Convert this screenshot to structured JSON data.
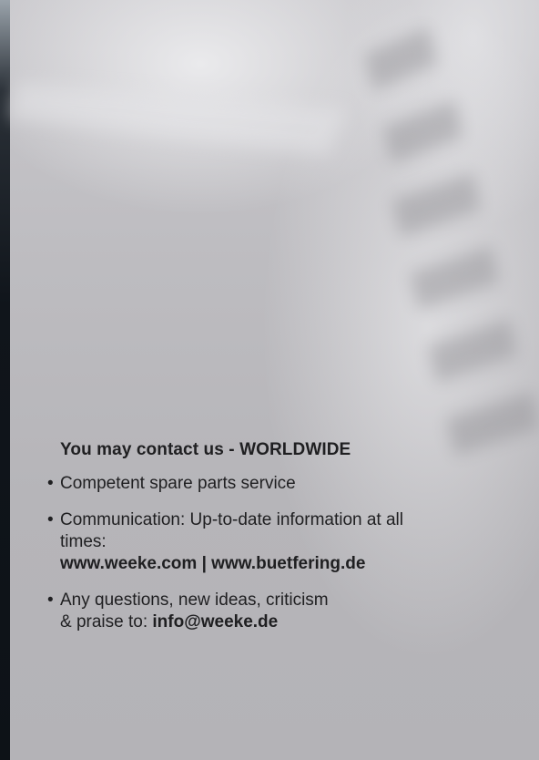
{
  "contact": {
    "heading": "You may contact us - WORLDWIDE",
    "items": [
      {
        "text": "Competent spare parts service"
      },
      {
        "text": "Communication: Up-to-date information at all times:",
        "links": "www.weeke.com | www.buetfering.de"
      },
      {
        "text_1": "Any questions, new ideas, criticism",
        "text_2": "& praise to: ",
        "email": "info@weeke.de"
      }
    ],
    "bullet": "•"
  }
}
